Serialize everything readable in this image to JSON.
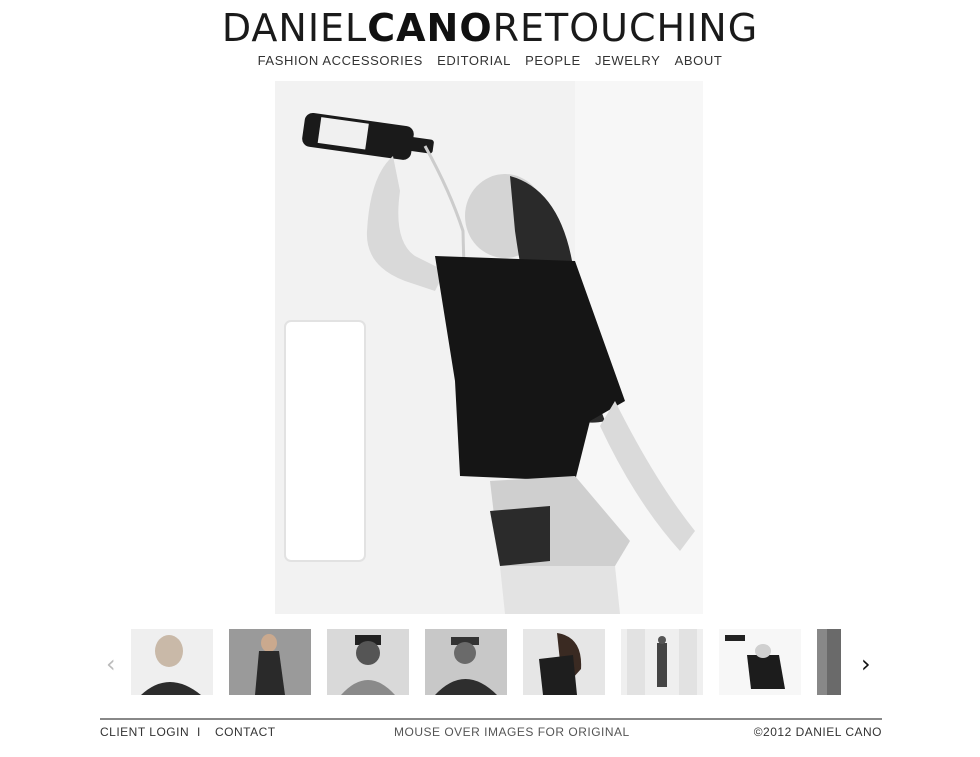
{
  "logo": {
    "part1": "DANIEL",
    "part2": "CANO",
    "part3": "RETOUCHING"
  },
  "nav": {
    "items": [
      "FASHION ACCESSORIES",
      "EDITORIAL",
      "PEOPLE",
      "JEWELRY",
      "ABOUT"
    ]
  },
  "hero": {
    "image": "woman-pouring-bottle-photo"
  },
  "thumbnails": {
    "prev_icon": "chevron-left-icon",
    "next_icon": "chevron-right-icon",
    "prev_glyph": "‹",
    "next_glyph": "›",
    "items": [
      "portrait-woman-1",
      "model-sitting",
      "man-cap",
      "man-hat",
      "woman-dark-hair",
      "man-walking",
      "woman-bottle",
      "partial-portrait"
    ]
  },
  "footer": {
    "client_login": "CLIENT LOGIN",
    "separator": "I",
    "contact": "CONTACT",
    "hint": "MOUSE OVER IMAGES FOR ORIGINAL",
    "copyright": "©2012 DANIEL CANO"
  }
}
